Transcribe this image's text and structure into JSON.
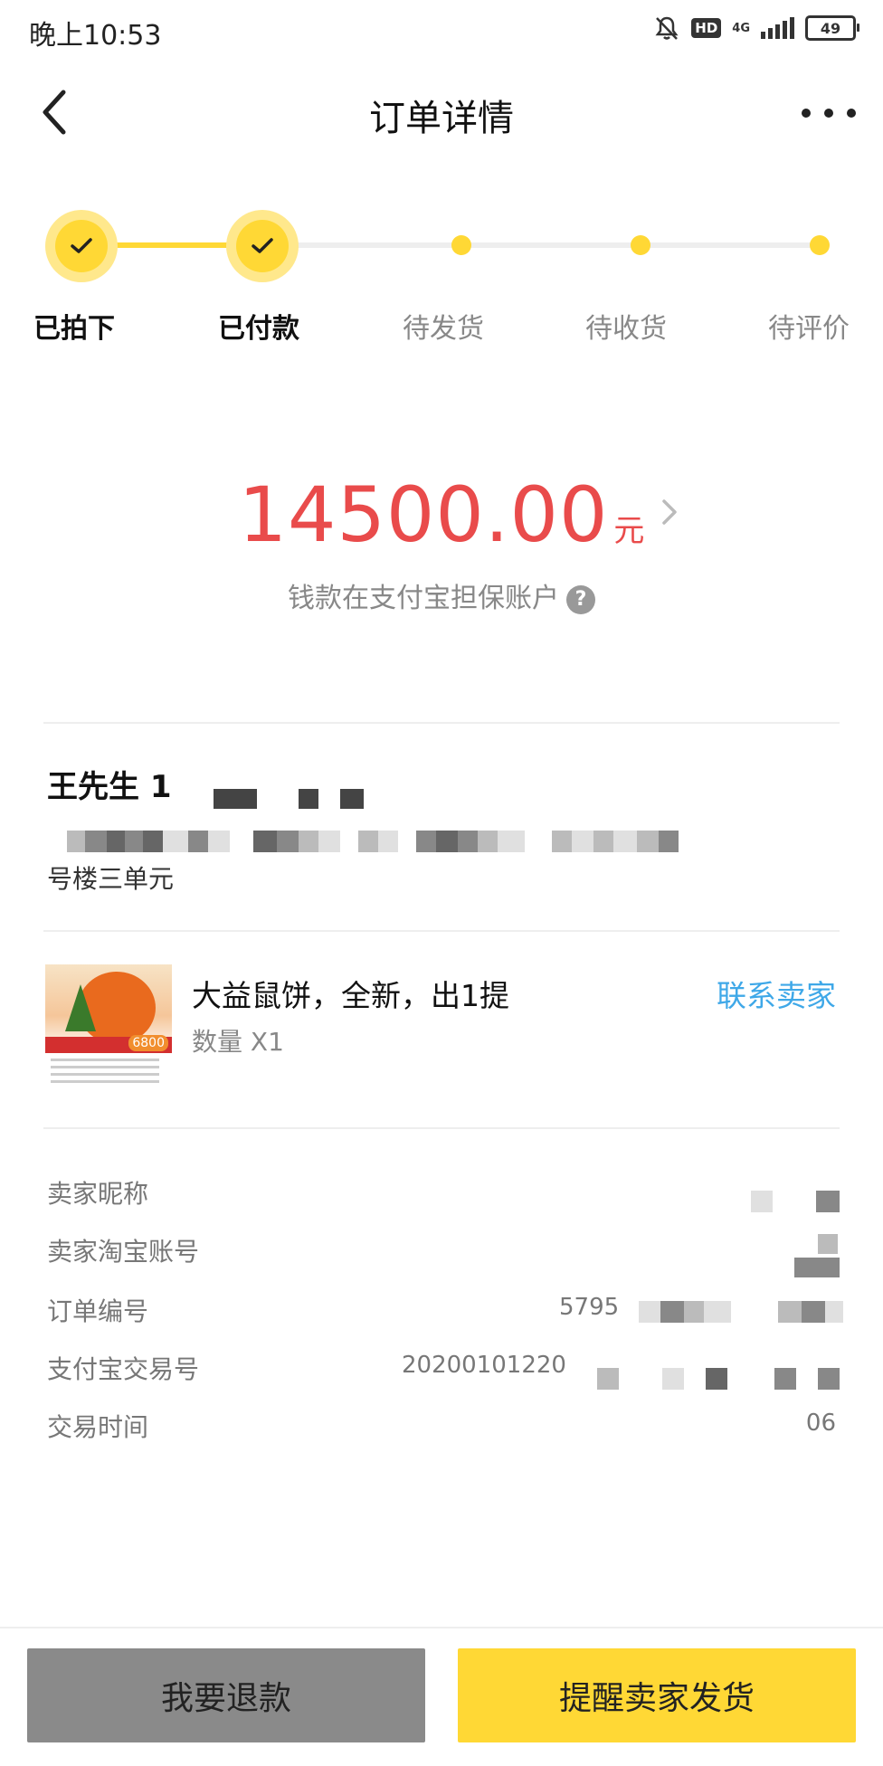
{
  "status_bar": {
    "time": "晚上10:53",
    "hd": "HD",
    "network": "4G",
    "battery": "49"
  },
  "nav": {
    "title": "订单详情"
  },
  "progress": {
    "steps": [
      {
        "label": "已拍下",
        "done": true
      },
      {
        "label": "已付款",
        "done": true
      },
      {
        "label": "待发货",
        "done": false
      },
      {
        "label": "待收货",
        "done": false
      },
      {
        "label": "待评价",
        "done": false
      }
    ]
  },
  "payment": {
    "amount": "14500.00",
    "currency": "元",
    "escrow_note": "钱款在支付宝担保账户",
    "help": "?"
  },
  "address": {
    "recipient": "王先生 1",
    "address_tail": "号楼三单元"
  },
  "product": {
    "title": "大益鼠饼，全新，出1提",
    "quantity": "数量 X1",
    "contact_seller": "联系卖家",
    "thumb_price": "6800"
  },
  "details": {
    "seller_nickname_label": "卖家昵称",
    "seller_account_label": "卖家淘宝账号",
    "order_no_label": "订单编号",
    "order_no_value": "5795",
    "alipay_trade_label": "支付宝交易号",
    "alipay_trade_value": "20200101220",
    "trade_time_label": "交易时间",
    "trade_time_value": "06"
  },
  "actions": {
    "refund": "我要退款",
    "remind": "提醒卖家发货"
  }
}
